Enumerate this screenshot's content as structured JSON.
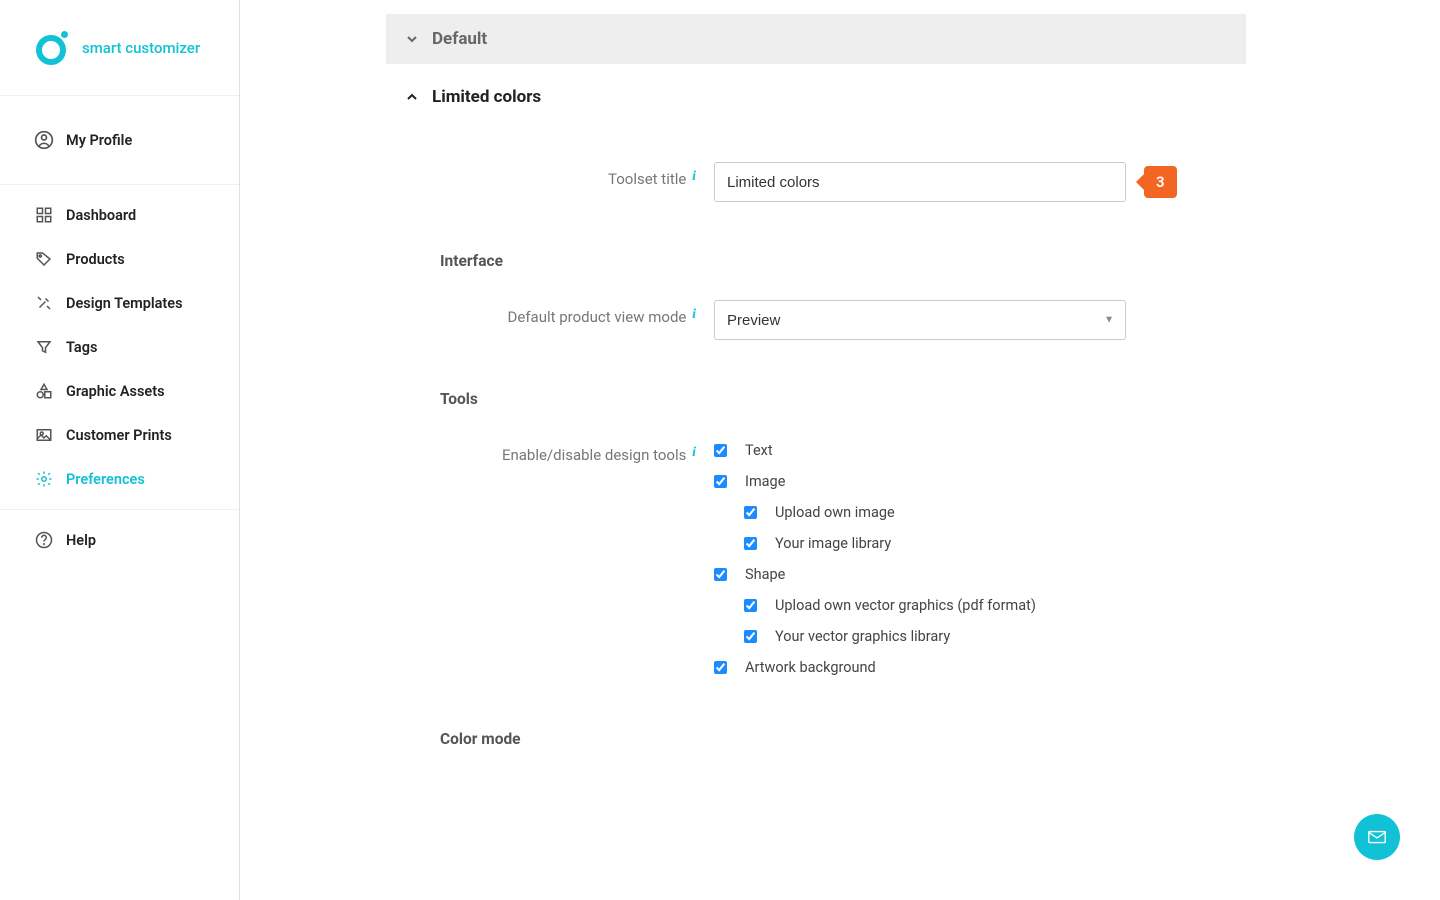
{
  "brand": {
    "name": "smart customizer"
  },
  "sidebar": {
    "profile": "My Profile",
    "items": [
      {
        "label": "Dashboard"
      },
      {
        "label": "Products"
      },
      {
        "label": "Design Templates"
      },
      {
        "label": "Tags"
      },
      {
        "label": "Graphic Assets"
      },
      {
        "label": "Customer Prints"
      },
      {
        "label": "Preferences"
      }
    ],
    "help": "Help"
  },
  "accordion": {
    "collapsed_title": "Default",
    "expanded_title": "Limited colors"
  },
  "form": {
    "toolset_title_label": "Toolset title",
    "toolset_title_value": "Limited colors",
    "toolset_badge": "3",
    "interface_heading": "Interface",
    "viewmode_label": "Default product view mode",
    "viewmode_value": "Preview",
    "tools_heading": "Tools",
    "tools_label": "Enable/disable design tools",
    "tools": {
      "text": "Text",
      "image": "Image",
      "image_upload": "Upload own image",
      "image_library": "Your image library",
      "shape": "Shape",
      "shape_upload": "Upload own vector graphics (pdf format)",
      "shape_library": "Your vector graphics library",
      "artwork_bg": "Artwork background"
    },
    "colormode_heading": "Color mode"
  }
}
